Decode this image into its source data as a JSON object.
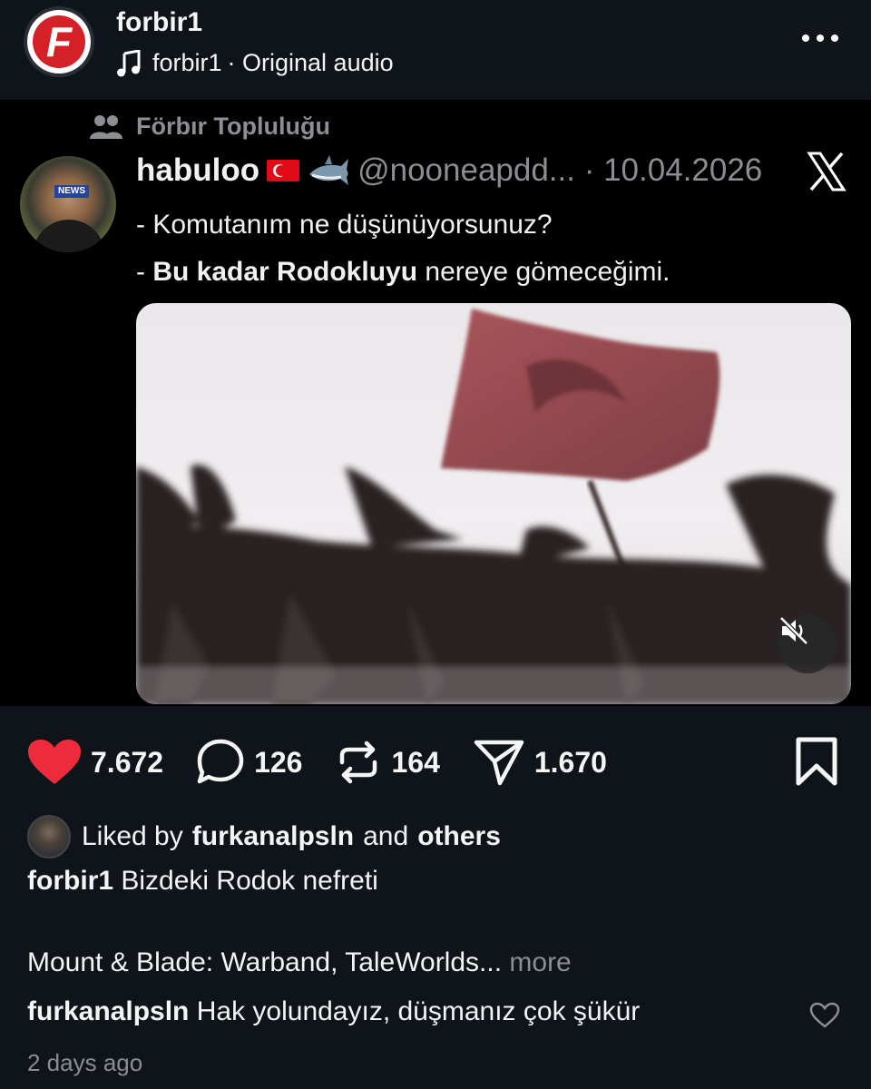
{
  "header": {
    "username": "forbir1",
    "audio_owner": "forbir1",
    "audio_label": "· Original audio"
  },
  "tweet": {
    "community": "Förbır Topluluğu",
    "display_name": "habuloo",
    "handle_date": "@nooneapdd... · 10.04.2026",
    "line1": "- Komutanım ne düşünüyorsunuz?",
    "line2_prefix": "- ",
    "line2_bold": "Bu kadar Rodokluyu",
    "line2_rest": " nereye gömeceğimi.",
    "avatar_badge": "NEWS"
  },
  "actions": {
    "likes": "7.672",
    "comments": "126",
    "reposts": "164",
    "shares": "1.670"
  },
  "liked_by": {
    "prefix": "Liked by",
    "user": "furkanalpsln",
    "middle": "and",
    "suffix": "others"
  },
  "caption": {
    "user": "forbir1",
    "text": "Bizdeki Rodok nefreti"
  },
  "game": {
    "text": "Mount & Blade: Warband, TaleWorlds...",
    "more": "more"
  },
  "comment": {
    "user": "furkanalpsln",
    "text": "Hak yolundayız, düşmanız çok şükür"
  },
  "time_ago": "2 days ago",
  "colors": {
    "background": "#0f141a",
    "like_red": "#ee2b3a",
    "muted": "#8a8d91"
  }
}
